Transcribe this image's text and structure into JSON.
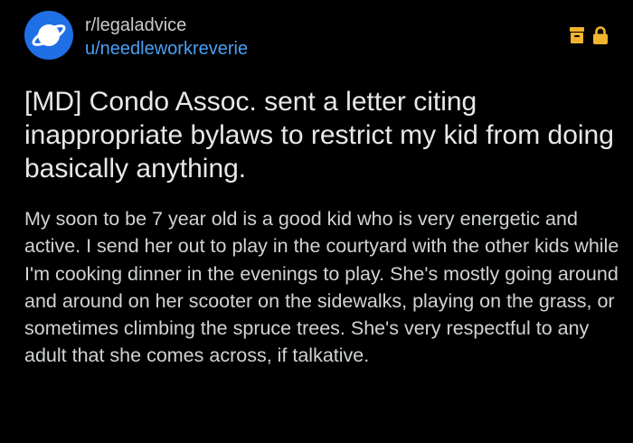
{
  "post": {
    "subreddit": "r/legaladvice",
    "username": "u/needleworkreverie",
    "title": "[MD] Condo Assoc. sent a letter citing inappropriate bylaws to restrict my kid from doing basically anything.",
    "body": "My soon to be 7 year old is a good kid who is very energetic and active. I send her out to play in the courtyard with the other kids while I'm cooking dinner in the evenings to play. She's mostly going around and around on her scooter on the sidewalks, playing on the grass, or sometimes climbing the spruce trees. She's very respectful to any adult that she comes across, if talkative."
  },
  "icons": {
    "avatar": "planet-icon",
    "archive": "archive-icon",
    "lock": "lock-icon"
  },
  "colors": {
    "background": "#000000",
    "avatar": "#1f6fe5",
    "username": "#4a9ff5",
    "status_icons": "#f0b430"
  }
}
